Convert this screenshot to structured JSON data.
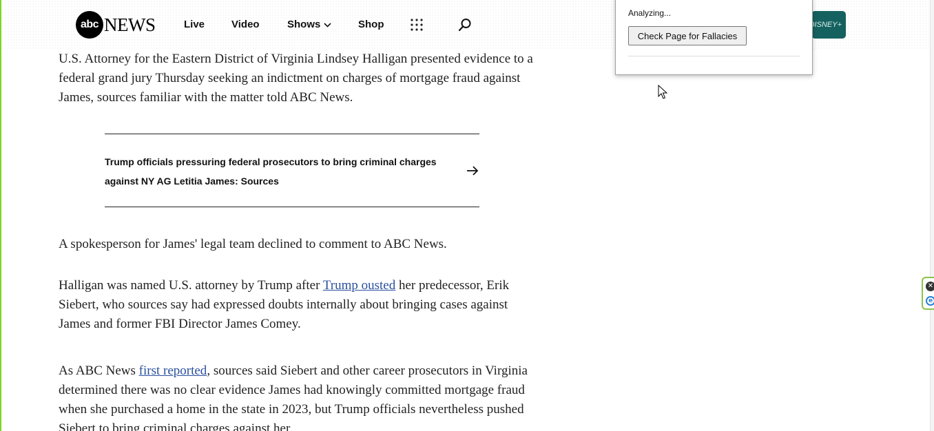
{
  "header": {
    "logo_abc": "abc",
    "logo_news": "NEWS",
    "nav": [
      "Live",
      "Video",
      "Shows",
      "Shop"
    ],
    "disney_label": "DISNEY+"
  },
  "popup": {
    "status": "Analyzing...",
    "button_label": "Check Page for Fallacies"
  },
  "article": {
    "p1": "U.S. Attorney for the Eastern District of Virginia Lindsey Halligan presented evidence to a federal grand jury Thursday seeking an indictment on charges of mortgage fraud against James, sources familiar with the matter told ABC News.",
    "related_title": "Trump officials pressuring federal prosecutors to bring criminal charges against NY AG Letitia James: Sources",
    "p2": "A spokesperson for James' legal team declined to comment to ABC News.",
    "p3_before": "Halligan was named U.S. attorney by Trump after ",
    "p3_link": "Trump ousted",
    "p3_after": " her predecessor, Erik Siebert, who sources say had expressed doubts internally about bringing cases against James and former FBI Director James Comey.",
    "p4_before": "As ABC News ",
    "p4_link": "first reported",
    "p4_after": ", sources said Siebert and other career prosecutors in Virginia determined there was no clear evidence James had knowingly committed mortgage fraud when she purchased a home in the state in 2023, but Trump officials nevertheless pushed Siebert to bring criminal charges against her"
  },
  "colors": {
    "accent_border": "#7ed321",
    "link": "#2a4f9e",
    "disney": "#15615f"
  },
  "icons": [
    "chevron-down-icon",
    "grid-icon",
    "search-icon",
    "arrow-right-icon",
    "mouse-cursor-icon",
    "close-icon",
    "extension-icon"
  ]
}
